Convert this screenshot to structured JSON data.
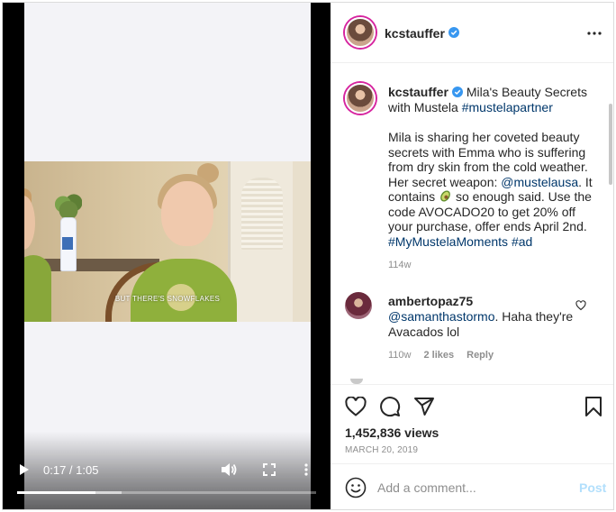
{
  "colors": {
    "accent": "#0095f6",
    "link": "#00376b",
    "muted": "#8e8e8e",
    "post_disabled": "#b2dffc",
    "verified": "#3897f0",
    "avatar_ring": "#d6249f"
  },
  "video": {
    "subtitle": "BUT THERE'S SNOWFLAKES",
    "time": "0:17 / 1:05",
    "progress_fraction": 0.262,
    "buffered_fraction": 0.35,
    "icons": {
      "play": "play-icon",
      "volume": "volume-icon",
      "fullscreen": "fullscreen-icon",
      "more": "more-vertical-icon"
    }
  },
  "header": {
    "username": "kcstauffer",
    "verified": true,
    "more_icon": "more-horizontal-icon"
  },
  "caption": {
    "username": "kcstauffer",
    "title": "Mila's Beauty Secrets with Mustela",
    "hashtag": "#mustelapartner",
    "text_1": "Mila is sharing her coveted beauty secrets with Emma who is suffering from dry skin from the cold weather. Her secret weapon:",
    "mention": "@mustelausa",
    "text_2": ". It contains",
    "emoji": "avocado",
    "text_3": "so enough said. Use the code AVOCADO20 to get 20% off your purchase, offer ends April 2nd.",
    "tag_1": "#MyMustelaMoments",
    "tag_2": "#ad",
    "age": "114w"
  },
  "comments": [
    {
      "username": "ambertopaz75",
      "mention": "@samanthastormo",
      "text": ". Haha they're Avacados lol",
      "age": "110w",
      "likes": "2 likes",
      "reply": "Reply"
    }
  ],
  "actions": {
    "icons": [
      "heart-icon",
      "comment-icon",
      "share-icon",
      "bookmark-icon"
    ],
    "views": "1,452,836 views",
    "date": "MARCH 20, 2019"
  },
  "add_comment": {
    "placeholder": "Add a comment...",
    "post_label": "Post",
    "emoji_icon": "smiley-icon"
  }
}
